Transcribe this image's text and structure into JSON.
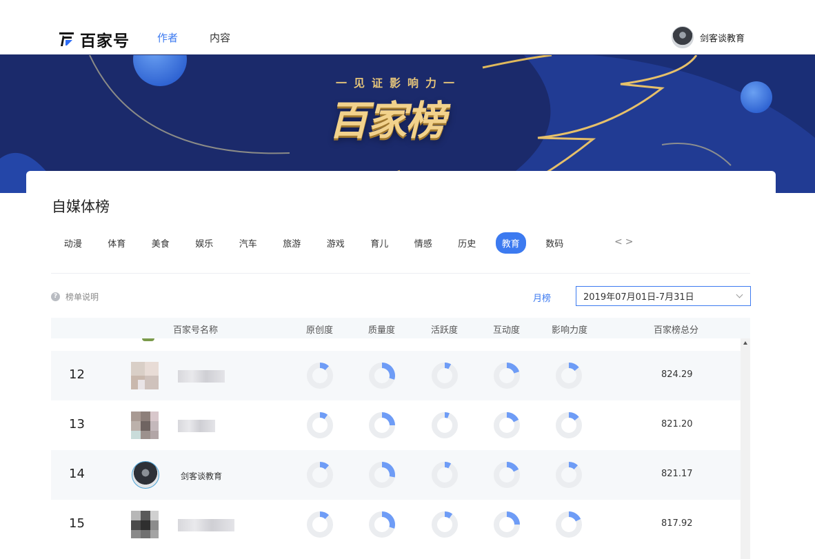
{
  "header": {
    "logo_text": "百家号",
    "nav": [
      {
        "label": "作者",
        "active": true
      },
      {
        "label": "内容",
        "active": false
      }
    ],
    "user_name": "剑客谈教育"
  },
  "banner": {
    "slogan": "一见证影响力一",
    "title": "百家榜"
  },
  "ranking": {
    "title": "自媒体榜",
    "categories": [
      "动漫",
      "体育",
      "美食",
      "娱乐",
      "汽车",
      "旅游",
      "游戏",
      "育儿",
      "情感",
      "历史",
      "教育",
      "数码"
    ],
    "active_category": "教育",
    "arrows": "<>",
    "explain_label": "榜单说明",
    "period_label": "月榜",
    "date_range": "2019年07月01日-7月31日",
    "columns": [
      "百家号名称",
      "原创度",
      "质量度",
      "活跃度",
      "互动度",
      "影响力度",
      "百家榜总分"
    ],
    "rows": [
      {
        "rank": "12",
        "name": "",
        "score": "824.29",
        "metrics": [
          0.12,
          0.3,
          0.08,
          0.2,
          0.14
        ]
      },
      {
        "rank": "13",
        "name": "",
        "score": "821.20",
        "metrics": [
          0.1,
          0.25,
          0.06,
          0.18,
          0.14
        ]
      },
      {
        "rank": "14",
        "name": "剑客谈教育",
        "score": "821.17",
        "metrics": [
          0.12,
          0.28,
          0.08,
          0.18,
          0.12
        ]
      },
      {
        "rank": "15",
        "name": "",
        "score": "817.92",
        "metrics": [
          0.12,
          0.3,
          0.1,
          0.25,
          0.18
        ]
      }
    ]
  },
  "colors": {
    "accent": "#3c7af0",
    "donut_fill": "#6e9cf6",
    "donut_track": "#ebedf0",
    "banner_bg": "#1b2a6b",
    "banner_gold": "#f2d28c"
  }
}
